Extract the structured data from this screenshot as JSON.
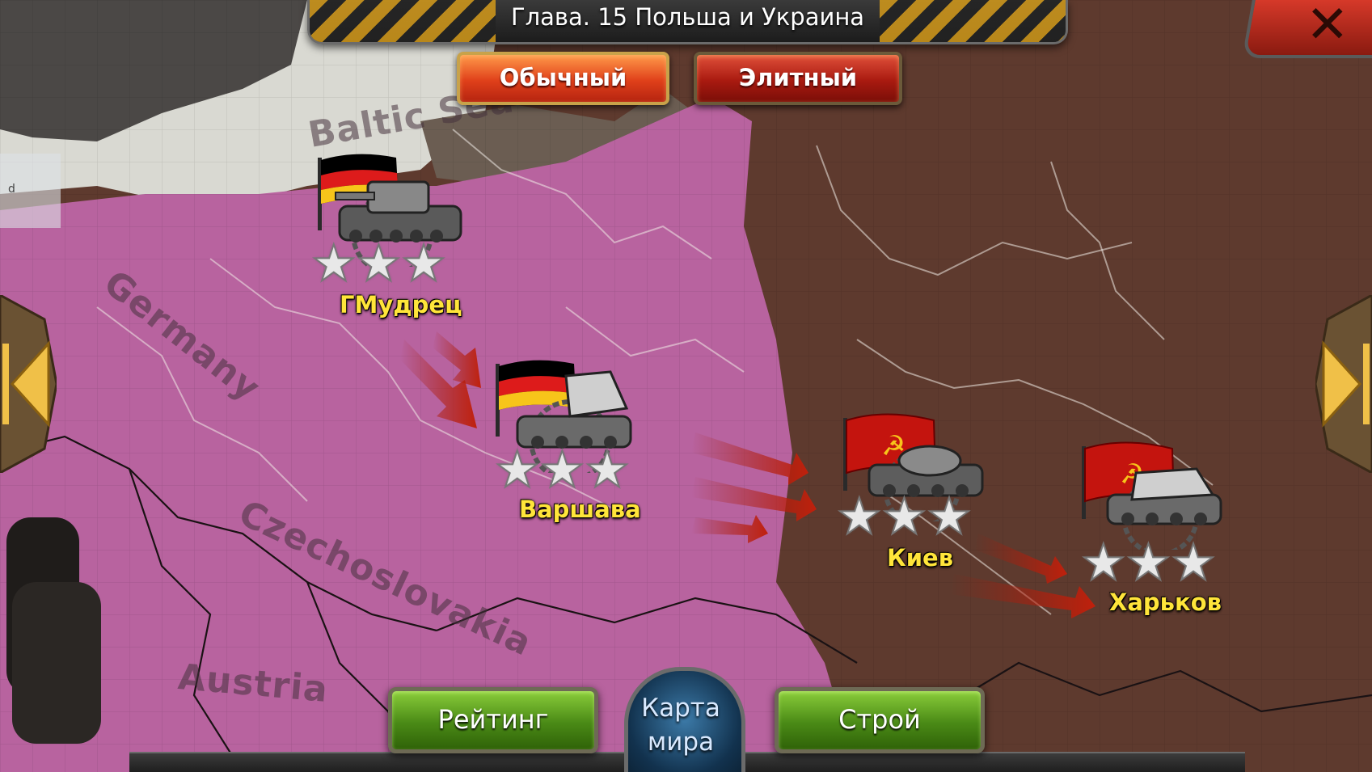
{
  "header": {
    "title": "Глава. 15 Польша и Украина"
  },
  "modes": {
    "normal": "Обычный",
    "elite": "Элитный"
  },
  "side_tab": {
    "label": "d"
  },
  "map_labels": {
    "baltic": "Baltic Sea",
    "germany": "Germany",
    "czechoslovakia": "Czechoslovakia",
    "austria": "Austria"
  },
  "stages": [
    {
      "name": "ГМудрец",
      "faction": "germany",
      "stars": 3
    },
    {
      "name": "Варшава",
      "faction": "germany",
      "stars": 3
    },
    {
      "name": "Киев",
      "faction": "ussr",
      "stars": 3
    },
    {
      "name": "Харьков",
      "faction": "ussr",
      "stars": 3
    }
  ],
  "bottom": {
    "rating": "Рейтинг",
    "world_map_line1": "Карта",
    "world_map_line2": "мира",
    "formation": "Строй"
  },
  "colors": {
    "german_territory": "#b8639f",
    "soviet_territory": "#5e3a2e",
    "sea": "#d9d9d2",
    "city_label": "#ffe53a"
  },
  "icons": {
    "close": "close-icon",
    "prev": "arrow-left-icon",
    "next": "arrow-right-icon",
    "star": "star-icon"
  }
}
